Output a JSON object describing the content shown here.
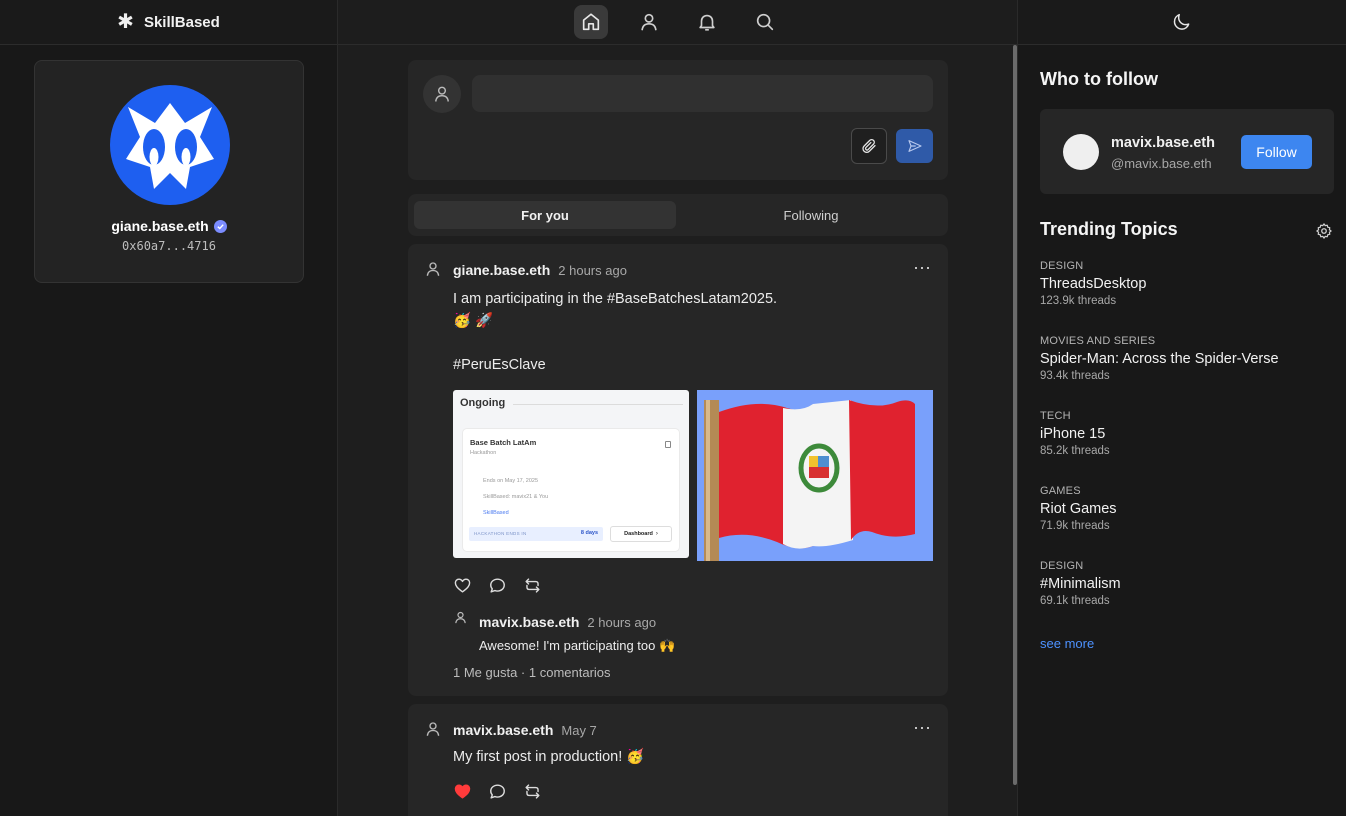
{
  "brand": {
    "name": "SkillBased"
  },
  "profile": {
    "name": "giane.base.eth",
    "address": "0x60a7...4716"
  },
  "nav": {
    "icons": [
      "home-icon",
      "user-icon",
      "bell-icon",
      "search-icon"
    ]
  },
  "compose": {
    "placeholder": ""
  },
  "tabs": [
    {
      "label": "For you"
    },
    {
      "label": "Following"
    }
  ],
  "posts": [
    {
      "author": "giane.base.eth",
      "time": "2 hours ago",
      "text": "I am participating in the #BaseBatchesLatam2025.\n🥳 🚀\n\n#PeruEsClave",
      "image1": {
        "heading": "Ongoing",
        "card_title": "Base Batch LatAm",
        "card_subtitle": "Hackathon",
        "ends": "Ends on May 17, 2025",
        "participants": "SkillBased: mavix21 & You",
        "org": "SkillBased",
        "countdown_label": "HACKATHON ENDS IN",
        "countdown_value": "8 days",
        "dashboard": "Dashboard"
      },
      "comment": {
        "author": "mavix.base.eth",
        "time": "2 hours ago",
        "text": "Awesome! I'm participating too 🙌"
      },
      "stats": "1 Me gusta · 1 comentarios"
    },
    {
      "author": "mavix.base.eth",
      "time": "May 7",
      "text": "My first post in production! 🥳",
      "liked": true
    }
  ],
  "who_to_follow": {
    "title": "Who to follow",
    "user": {
      "name": "mavix.base.eth",
      "handle": "@mavix.base.eth",
      "button": "Follow"
    }
  },
  "trending": {
    "title": "Trending Topics",
    "topics": [
      {
        "category": "DESIGN",
        "title": "ThreadsDesktop",
        "count": "123.9k threads"
      },
      {
        "category": "MOVIES AND SERIES",
        "title": "Spider-Man: Across the Spider-Verse",
        "count": "93.4k threads"
      },
      {
        "category": "TECH",
        "title": "iPhone 15",
        "count": "85.2k threads"
      },
      {
        "category": "GAMES",
        "title": "Riot Games",
        "count": "71.9k threads"
      },
      {
        "category": "DESIGN",
        "title": "#Minimalism",
        "count": "69.1k threads"
      }
    ],
    "see_more": "see more"
  },
  "colors": {
    "accent": "#3d86f0",
    "like": "#ff3b3b",
    "avatar_blue": "#1e5ff0"
  }
}
